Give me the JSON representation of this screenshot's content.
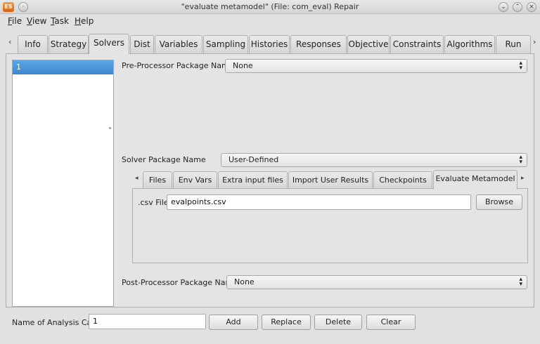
{
  "window": {
    "title": "\"evaluate metamodel\" (File: com_eval)   Repair",
    "app_icon_text": "ES",
    "controls": [
      "chevron-down-icon",
      "chevron-up-icon",
      "close-icon"
    ]
  },
  "menu": {
    "items": [
      {
        "underline": "F",
        "rest": "ile"
      },
      {
        "underline": "V",
        "rest": "iew"
      },
      {
        "underline": "T",
        "rest": "ask"
      },
      {
        "underline": "H",
        "rest": "elp"
      }
    ]
  },
  "tabs": {
    "scroll_left": "‹",
    "scroll_right": "›",
    "items": [
      "Info",
      "Strategy",
      "Solvers",
      "Dist",
      "Variables",
      "Sampling",
      "Histories",
      "Responses",
      "Objective",
      "Constraints",
      "Algorithms",
      "Run"
    ],
    "active": "Solvers"
  },
  "case_list": {
    "items": [
      "1"
    ],
    "selected": "1"
  },
  "preprocessor": {
    "label": "Pre-Processor Package Name",
    "value": "None"
  },
  "solver": {
    "label": "Solver Package Name",
    "value": "User-Defined"
  },
  "subtabs": {
    "items": [
      "Files",
      "Env Vars",
      "Extra input files",
      "Import User Results",
      "Checkpoints",
      "Evaluate Metamodel"
    ],
    "active": "Evaluate Metamodel",
    "scroll_left": "◂",
    "scroll_right": "▸"
  },
  "csv": {
    "label": ".csv File",
    "value": "evalpoints.csv",
    "browse_label": "Browse"
  },
  "postprocessor": {
    "label": "Post-Processor Package Name",
    "value": "None"
  },
  "bottom": {
    "name_label": "Name of Analysis Case",
    "name_value": "1",
    "add_label": "Add",
    "replace_label": "Replace",
    "delete_label": "Delete",
    "clear_label": "Clear"
  },
  "colors": {
    "selection": "#3f86cf",
    "window_bg": "#e1e1e1",
    "app_icon": "#e07020"
  }
}
